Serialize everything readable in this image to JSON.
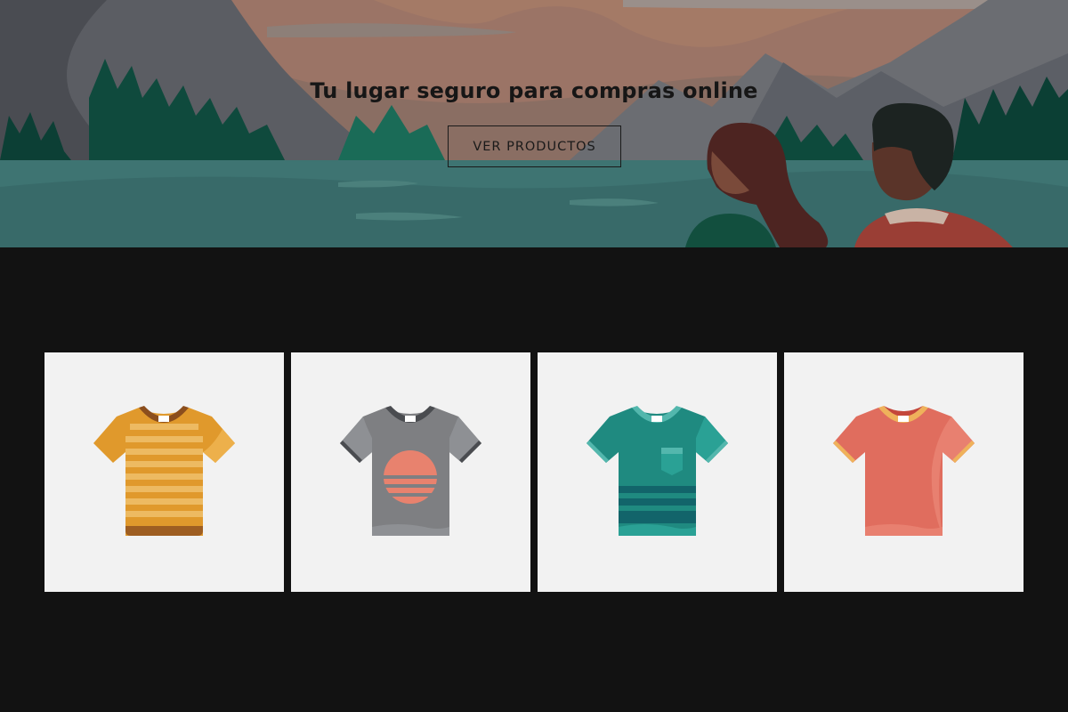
{
  "hero": {
    "title": "Tu lugar seguro para compras online",
    "button_label": "VER PRODUCTOS",
    "illustration": "mountain-lake-couple-illustration"
  },
  "products": [
    {
      "icon": "striped-tshirt-icon",
      "color": "#E0992C"
    },
    {
      "icon": "sunset-tshirt-icon",
      "color": "#7E7F82"
    },
    {
      "icon": "pocket-tshirt-icon",
      "color": "#1F8A80"
    },
    {
      "icon": "ringer-tshirt-icon",
      "color": "#E06D5E"
    }
  ],
  "colors": {
    "page_background": "#121212",
    "card_background": "#F2F2F2",
    "title_text": "#161616"
  }
}
